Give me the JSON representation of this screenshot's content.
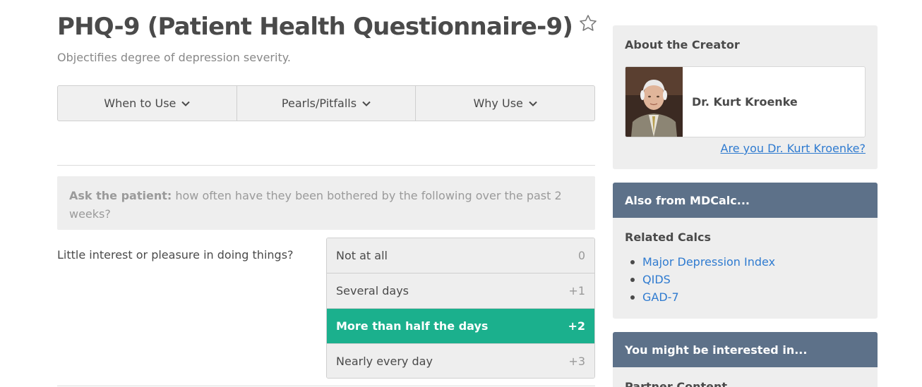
{
  "calculator": {
    "title": "PHQ-9 (Patient Health Questionnaire-9)",
    "subtitle": "Objectifies degree of depression severity."
  },
  "tabs": [
    {
      "label": "When to Use",
      "icon": "chevron-down-icon"
    },
    {
      "label": "Pearls/Pitfalls",
      "icon": "chevron-down-icon"
    },
    {
      "label": "Why Use",
      "icon": "chevron-down-icon"
    }
  ],
  "instructions": {
    "bold": "Ask the patient:",
    "text": " how often have they been bothered by the following over the past 2 weeks?"
  },
  "question": {
    "label": "Little interest or pleasure in doing things?",
    "options": [
      {
        "label": "Not at all",
        "points": "0",
        "selected": false
      },
      {
        "label": "Several days",
        "points": "+1",
        "selected": false
      },
      {
        "label": "More than half the days",
        "points": "+2",
        "selected": true
      },
      {
        "label": "Nearly every day",
        "points": "+3",
        "selected": false
      }
    ]
  },
  "creator": {
    "heading": "About the Creator",
    "name": "Dr. Kurt Kroenke",
    "claim_link": "Are you Dr. Kurt Kroenke?"
  },
  "also_from": {
    "heading": "Also from MDCalc...",
    "related_heading": "Related Calcs",
    "related": [
      "Major Depression Index",
      "QIDS",
      "GAD-7"
    ]
  },
  "interested": {
    "heading": "You might be interested in...",
    "sub": "Partner Content"
  },
  "colors": {
    "selected_option": "#1bb08d",
    "panel_header": "#5d7189",
    "link": "#2f7bd0"
  }
}
